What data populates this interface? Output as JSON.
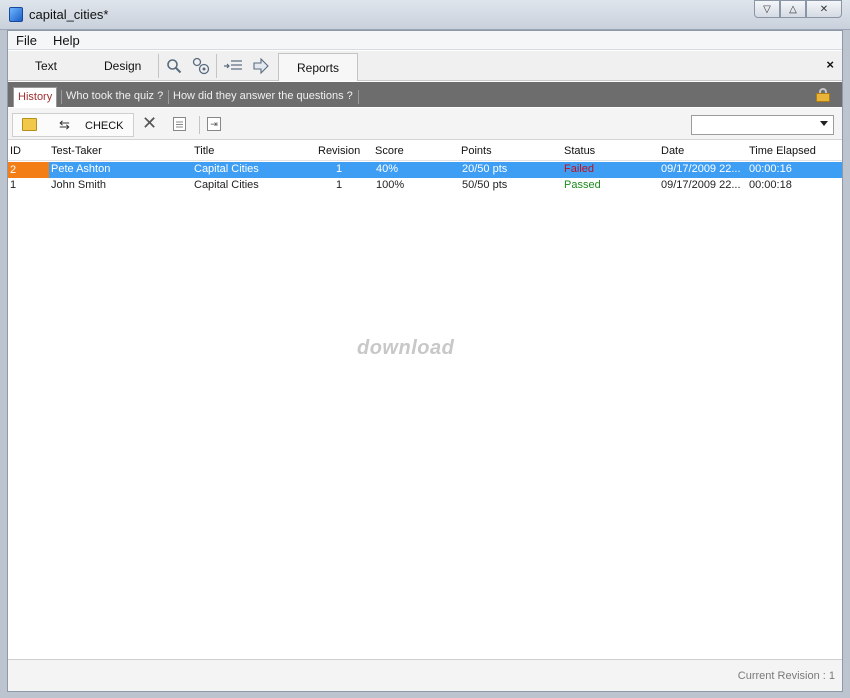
{
  "window": {
    "title": "capital_cities*"
  },
  "window_controls": {
    "minimize": "▽",
    "restore": "△",
    "close": "✕"
  },
  "menu": [
    {
      "label": "File"
    },
    {
      "label": "Help"
    }
  ],
  "toolbar": {
    "text_label": "Text",
    "design_label": "Design",
    "reports_label": "Reports",
    "close_symbol": "×"
  },
  "subtabs": [
    {
      "label": "History",
      "active": true
    },
    {
      "label": "Who took the quiz ?",
      "active": false
    },
    {
      "label": "How did they answer the questions ?",
      "active": false
    }
  ],
  "actions": {
    "check_label": "CHECK",
    "delete_symbol": "✕",
    "filter_value": ""
  },
  "table": {
    "columns": [
      "ID",
      "Test-Taker",
      "Title",
      "Revision",
      "Score",
      "Points",
      "Status",
      "Date",
      "Time Elapsed"
    ],
    "rows": [
      {
        "id": "2",
        "taker": "Pete Ashton",
        "title": "Capital Cities",
        "revision": "1",
        "score": "40%",
        "points": "20/50 pts",
        "status": "Failed",
        "date": "09/17/2009 22...",
        "elapsed": "00:00:16",
        "selected": true
      },
      {
        "id": "1",
        "taker": "John Smith",
        "title": "Capital Cities",
        "revision": "1",
        "score": "100%",
        "points": "50/50 pts",
        "status": "Passed",
        "date": "09/17/2009 22...",
        "elapsed": "00:00:18",
        "selected": false
      }
    ]
  },
  "watermark": "download",
  "status": {
    "revision_text": "Current Revision : 1"
  },
  "colors": {
    "selected_row": "#3e9ef3",
    "selected_id": "#f47e16",
    "failed": "#d0253a",
    "passed": "#1e8a1e"
  }
}
